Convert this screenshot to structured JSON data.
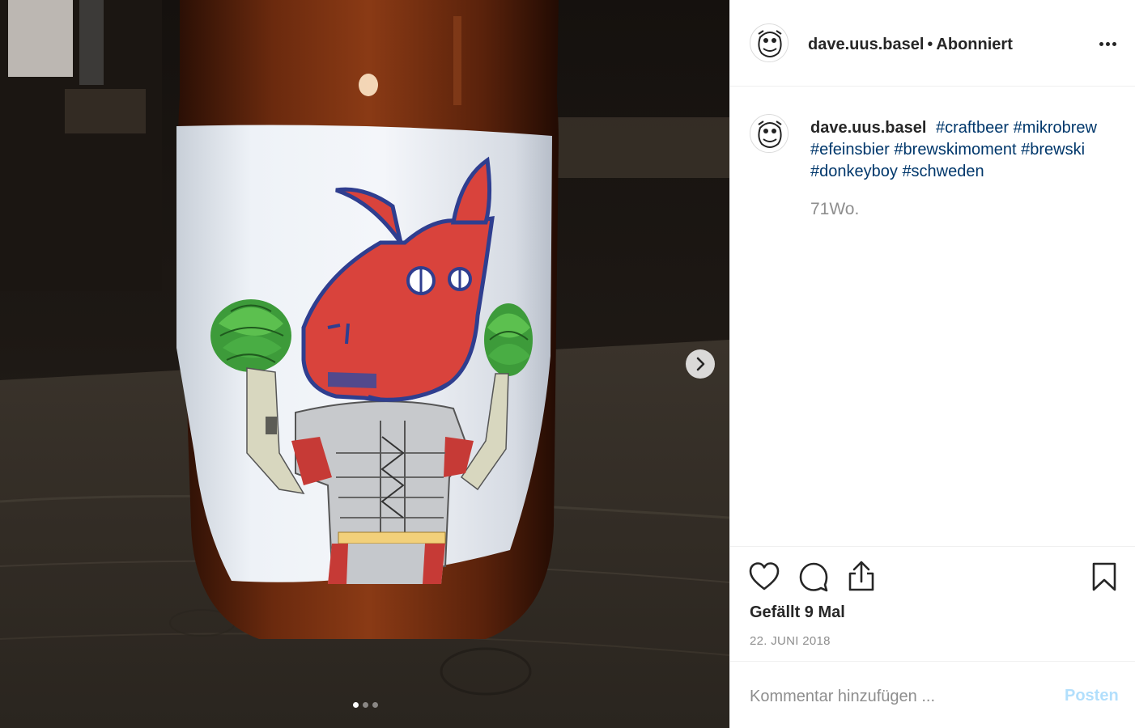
{
  "post": {
    "author": "dave.uus.basel",
    "separator": "•",
    "follow_status": "Abonniert",
    "caption": {
      "username": "dave.uus.basel",
      "hashtags": [
        "#craftbeer",
        "#mikrobrew",
        "#efeinsbier",
        "#brewskimoment",
        "#brewski",
        "#donkeyboy",
        "#schweden"
      ]
    },
    "relative_time": "71Wo.",
    "likes_text": "Gefällt 9 Mal",
    "date": "22. JUNI 2018",
    "comment": {
      "placeholder": "Kommentar hinzufügen ...",
      "value": "",
      "submit_label": "Posten"
    },
    "carousel": {
      "total": 3,
      "current": 1
    }
  },
  "icons": {
    "more": "more-options-icon",
    "like": "heart-icon",
    "comment": "comment-bubble-icon",
    "share": "share-icon",
    "save": "bookmark-icon",
    "next": "chevron-right-icon"
  },
  "colors": {
    "text": "#262626",
    "hashtag": "#00376b",
    "muted": "#8e8e8e",
    "post_button_disabled": "#b2dffc",
    "divider": "#efefef"
  }
}
